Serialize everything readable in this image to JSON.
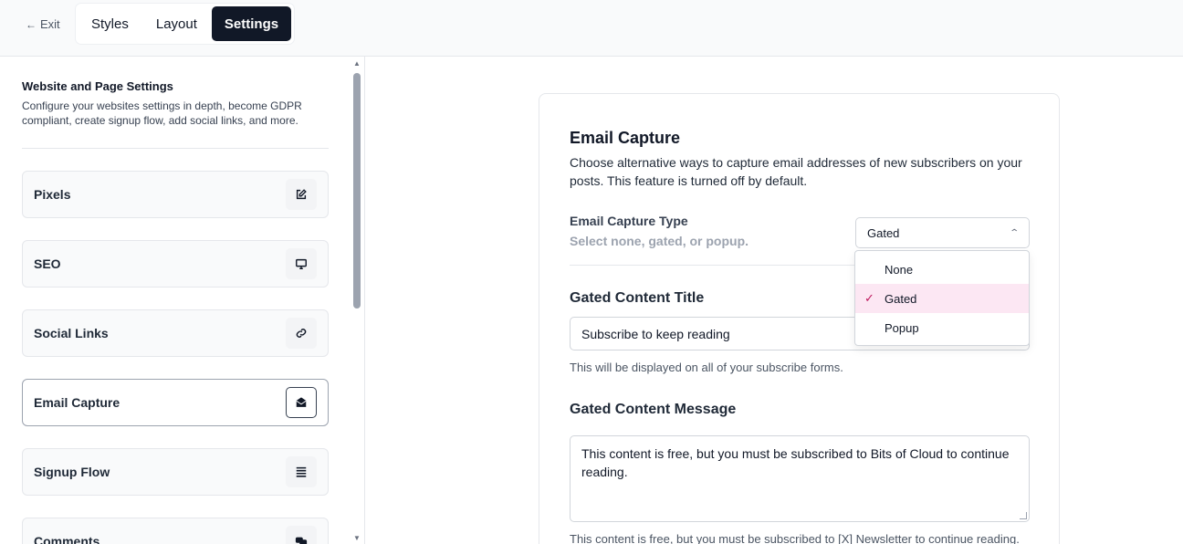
{
  "topbar": {
    "exit_label": "Exit",
    "tabs": [
      {
        "label": "Styles"
      },
      {
        "label": "Layout"
      },
      {
        "label": "Settings"
      }
    ]
  },
  "sidebar": {
    "title": "Website and Page Settings",
    "description": "Configure your websites settings in depth, become GDPR compliant, create signup flow, add social links, and more.",
    "items": [
      {
        "label": "Pixels",
        "icon": "edit-icon"
      },
      {
        "label": "SEO",
        "icon": "monitor-icon"
      },
      {
        "label": "Social Links",
        "icon": "link-icon"
      },
      {
        "label": "Email Capture",
        "icon": "envelope-open-icon"
      },
      {
        "label": "Signup Flow",
        "icon": "list-icon"
      },
      {
        "label": "Comments",
        "icon": "chat-icon"
      }
    ]
  },
  "main": {
    "title": "Email Capture",
    "description": "Choose alternative ways to capture email addresses of new subscribers on your posts. This feature is turned off by default.",
    "capture_type_label": "Email Capture Type",
    "capture_type_help": "Select none, gated, or popup.",
    "capture_type_value": "Gated",
    "options": [
      "None",
      "Gated",
      "Popup"
    ],
    "gated_title_label": "Gated Content Title",
    "gated_title_value": "Subscribe to keep reading",
    "gated_title_help": "This will be displayed on all of your subscribe forms.",
    "gated_message_label": "Gated Content Message",
    "gated_message_value": "This content is free, but you must be subscribed to Bits of Cloud to continue reading.",
    "gated_message_help": "This content is free, but you must be subscribed to [X] Newsletter to continue reading."
  },
  "colors": {
    "accent": "#111827",
    "selected_option_bg": "#fce7f3",
    "check": "#be185d"
  }
}
